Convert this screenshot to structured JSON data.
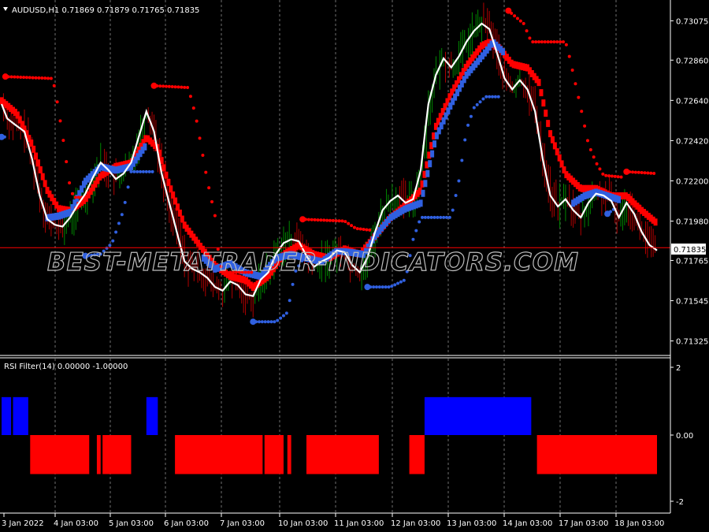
{
  "main_panel": {
    "header": "AUDUSD,H1  0.71869 0.71879 0.71765 0.71835",
    "symbol_menu_icon": "triangle-down-icon",
    "price_labels": [
      "0.73075",
      "0.72860",
      "0.72640",
      "0.72420",
      "0.72200",
      "0.71980",
      "0.71765",
      "0.71545",
      "0.71325"
    ],
    "current_price": "0.71835",
    "watermark": "BEST-METATRADER-INDICATORS.COM"
  },
  "sub_panel": {
    "header": "RSI Filter(14) 0.00000 -1.00000",
    "scale_labels": [
      "2",
      "0.00",
      "-2"
    ]
  },
  "x_axis": {
    "labels": [
      "3 Jan 2022",
      "4 Jan 03:00",
      "5 Jan 03:00",
      "6 Jan 03:00",
      "7 Jan 03:00",
      "10 Jan 03:00",
      "11 Jan 03:00",
      "12 Jan 03:00",
      "13 Jan 03:00",
      "14 Jan 03:00",
      "17 Jan 03:00",
      "18 Jan 03:00"
    ]
  },
  "colors": {
    "background": "#000000",
    "grid": "#ffffff",
    "bull_candle": "#00a000",
    "bear_candle": "#d00000",
    "band_red": "#ff0000",
    "band_blue": "#3060e0",
    "price_line": "#ffffff",
    "current_price_line": "#ff0000",
    "rsi_up": "#0000ff",
    "rsi_down": "#ff0000"
  },
  "chart_data": {
    "type": "line",
    "y_range": [
      0.7125,
      0.7318
    ],
    "price_line": [
      [
        0,
        0.7262
      ],
      [
        3,
        0.7254
      ],
      [
        8,
        0.725
      ],
      [
        12,
        0.7247
      ],
      [
        16,
        0.7232
      ],
      [
        20,
        0.7212
      ],
      [
        24,
        0.7199
      ],
      [
        28,
        0.7196
      ],
      [
        32,
        0.7195
      ],
      [
        36,
        0.72
      ],
      [
        40,
        0.7207
      ],
      [
        44,
        0.7213
      ],
      [
        48,
        0.7222
      ],
      [
        52,
        0.723
      ],
      [
        56,
        0.7226
      ],
      [
        60,
        0.7221
      ],
      [
        64,
        0.7224
      ],
      [
        68,
        0.723
      ],
      [
        72,
        0.7244
      ],
      [
        76,
        0.7258
      ],
      [
        80,
        0.7247
      ],
      [
        84,
        0.7224
      ],
      [
        88,
        0.7208
      ],
      [
        92,
        0.7192
      ],
      [
        96,
        0.7176
      ],
      [
        100,
        0.7172
      ],
      [
        104,
        0.717
      ],
      [
        108,
        0.7167
      ],
      [
        112,
        0.7162
      ],
      [
        116,
        0.716
      ],
      [
        120,
        0.7165
      ],
      [
        124,
        0.7163
      ],
      [
        128,
        0.7158
      ],
      [
        132,
        0.7157
      ],
      [
        136,
        0.7166
      ],
      [
        140,
        0.717
      ],
      [
        144,
        0.718
      ],
      [
        148,
        0.7186
      ],
      [
        152,
        0.7188
      ],
      [
        156,
        0.7187
      ],
      [
        160,
        0.7179
      ],
      [
        164,
        0.7173
      ],
      [
        168,
        0.7176
      ],
      [
        172,
        0.7178
      ],
      [
        176,
        0.7182
      ],
      [
        180,
        0.7181
      ],
      [
        184,
        0.7174
      ],
      [
        188,
        0.717
      ],
      [
        192,
        0.7178
      ],
      [
        196,
        0.7192
      ],
      [
        200,
        0.7204
      ],
      [
        204,
        0.7209
      ],
      [
        208,
        0.7212
      ],
      [
        212,
        0.7208
      ],
      [
        216,
        0.721
      ],
      [
        220,
        0.7226
      ],
      [
        224,
        0.7262
      ],
      [
        228,
        0.7278
      ],
      [
        232,
        0.7287
      ],
      [
        236,
        0.7282
      ],
      [
        240,
        0.7288
      ],
      [
        244,
        0.7296
      ],
      [
        248,
        0.7302
      ],
      [
        252,
        0.7306
      ],
      [
        256,
        0.7303
      ],
      [
        260,
        0.729
      ],
      [
        264,
        0.7276
      ],
      [
        268,
        0.727
      ],
      [
        272,
        0.7275
      ],
      [
        276,
        0.727
      ],
      [
        280,
        0.7258
      ],
      [
        284,
        0.7232
      ],
      [
        288,
        0.7212
      ],
      [
        292,
        0.7206
      ],
      [
        296,
        0.721
      ],
      [
        300,
        0.7204
      ],
      [
        304,
        0.72
      ],
      [
        308,
        0.7208
      ],
      [
        312,
        0.7213
      ],
      [
        316,
        0.7212
      ],
      [
        320,
        0.7209
      ],
      [
        324,
        0.72
      ],
      [
        328,
        0.7208
      ],
      [
        332,
        0.7202
      ],
      [
        336,
        0.7192
      ],
      [
        340,
        0.7185
      ],
      [
        344,
        0.7182
      ]
    ],
    "red_band": [
      [
        0,
        0.7264
      ],
      [
        8,
        0.7257
      ],
      [
        16,
        0.724
      ],
      [
        24,
        0.7215
      ],
      [
        30,
        0.7205
      ],
      [
        36,
        0.7204
      ],
      [
        44,
        0.721
      ],
      [
        52,
        0.7223
      ],
      [
        60,
        0.7228
      ],
      [
        68,
        0.723
      ],
      [
        76,
        0.7244
      ],
      [
        82,
        0.7238
      ],
      [
        88,
        0.7218
      ],
      [
        96,
        0.7196
      ],
      [
        104,
        0.7185
      ],
      [
        112,
        0.7174
      ],
      [
        120,
        0.7168
      ],
      [
        128,
        0.7166
      ],
      [
        132,
        0.7162
      ],
      [
        140,
        0.7168
      ],
      [
        148,
        0.718
      ],
      [
        156,
        0.7185
      ],
      [
        164,
        0.718
      ],
      [
        172,
        0.7178
      ],
      [
        180,
        0.7183
      ],
      [
        188,
        0.718
      ],
      [
        196,
        0.719
      ],
      [
        204,
        0.72
      ],
      [
        212,
        0.7207
      ],
      [
        220,
        0.7215
      ],
      [
        228,
        0.725
      ],
      [
        236,
        0.7268
      ],
      [
        244,
        0.7283
      ],
      [
        252,
        0.7294
      ],
      [
        256,
        0.7296
      ],
      [
        262,
        0.7292
      ],
      [
        268,
        0.7284
      ],
      [
        276,
        0.7282
      ],
      [
        282,
        0.7274
      ],
      [
        288,
        0.7246
      ],
      [
        296,
        0.7224
      ],
      [
        304,
        0.7216
      ],
      [
        312,
        0.7216
      ],
      [
        320,
        0.7212
      ],
      [
        328,
        0.7212
      ],
      [
        336,
        0.7204
      ],
      [
        344,
        0.7197
      ]
    ],
    "blue_band": [
      [
        24,
        0.72
      ],
      [
        30,
        0.7201
      ],
      [
        36,
        0.7203
      ],
      [
        44,
        0.722
      ],
      [
        52,
        0.7228
      ],
      [
        60,
        0.7226
      ],
      [
        68,
        0.7228
      ],
      [
        76,
        0.724
      ],
      [
        106,
        0.7178
      ],
      [
        112,
        0.7172
      ],
      [
        120,
        0.7175
      ],
      [
        128,
        0.717
      ],
      [
        136,
        0.7168
      ],
      [
        144,
        0.7178
      ],
      [
        152,
        0.718
      ],
      [
        160,
        0.7178
      ],
      [
        168,
        0.7176
      ],
      [
        176,
        0.7182
      ],
      [
        184,
        0.7181
      ],
      [
        190,
        0.718
      ],
      [
        196,
        0.719
      ],
      [
        204,
        0.72
      ],
      [
        212,
        0.7205
      ],
      [
        220,
        0.7208
      ],
      [
        228,
        0.7244
      ],
      [
        236,
        0.7262
      ],
      [
        244,
        0.7278
      ],
      [
        252,
        0.7288
      ],
      [
        258,
        0.7296
      ],
      [
        264,
        0.729
      ],
      [
        300,
        0.7208
      ],
      [
        306,
        0.7212
      ],
      [
        312,
        0.7214
      ],
      [
        318,
        0.7212
      ],
      [
        324,
        0.721
      ]
    ],
    "red_stop": [
      [
        [
          2,
          0.7277
        ],
        [
          26,
          0.7276
        ],
        [
          28,
          0.7271
        ],
        [
          32,
          0.7245
        ],
        [
          36,
          0.7216
        ],
        [
          38,
          0.7211
        ],
        [
          44,
          0.7211
        ]
      ],
      [
        [
          80,
          0.7272
        ],
        [
          98,
          0.7271
        ],
        [
          102,
          0.7255
        ],
        [
          108,
          0.722
        ],
        [
          112,
          0.7201
        ],
        [
          114,
          0.7178
        ],
        [
          116,
          0.717
        ],
        [
          132,
          0.717
        ]
      ],
      [
        [
          158,
          0.7199
        ],
        [
          180,
          0.7198
        ],
        [
          186,
          0.7194
        ],
        [
          194,
          0.7193
        ]
      ],
      [
        [
          266,
          0.7313
        ],
        [
          274,
          0.7306
        ],
        [
          278,
          0.7296
        ],
        [
          296,
          0.7296
        ],
        [
          298,
          0.7288
        ],
        [
          304,
          0.726
        ],
        [
          308,
          0.724
        ],
        [
          312,
          0.723
        ],
        [
          316,
          0.7223
        ],
        [
          326,
          0.7222
        ]
      ],
      [
        [
          328,
          0.7225
        ],
        [
          344,
          0.7224
        ]
      ]
    ],
    "blue_stop": [
      [
        [
          0,
          0.7244
        ],
        [
          2,
          0.7244
        ]
      ],
      [
        [
          44,
          0.7179
        ],
        [
          52,
          0.718
        ],
        [
          58,
          0.7186
        ],
        [
          64,
          0.7204
        ],
        [
          68,
          0.7225
        ],
        [
          80,
          0.7225
        ]
      ],
      [
        [
          132,
          0.7143
        ],
        [
          144,
          0.7143
        ],
        [
          150,
          0.7148
        ],
        [
          154,
          0.717
        ],
        [
          158,
          0.7177
        ]
      ],
      [
        [
          192,
          0.7162
        ],
        [
          204,
          0.7162
        ],
        [
          212,
          0.7166
        ],
        [
          216,
          0.7188
        ],
        [
          220,
          0.72
        ],
        [
          236,
          0.72
        ],
        [
          240,
          0.722
        ],
        [
          244,
          0.7248
        ],
        [
          248,
          0.726
        ],
        [
          254,
          0.7266
        ],
        [
          262,
          0.7266
        ]
      ],
      [
        [
          318,
          0.7202
        ],
        [
          322,
          0.7205
        ]
      ]
    ],
    "horizontal_level": 0.71835,
    "rsi_filter": {
      "y_range": [
        -2.0,
        2.0
      ],
      "up_blocks": [
        [
          0,
          5
        ],
        [
          6,
          14
        ],
        [
          76,
          82
        ],
        [
          222,
          278
        ]
      ],
      "down_blocks": [
        [
          15,
          46
        ],
        [
          50,
          52
        ],
        [
          53,
          68
        ],
        [
          91,
          137
        ],
        [
          138,
          148
        ],
        [
          150,
          152
        ],
        [
          160,
          198
        ],
        [
          214,
          222
        ],
        [
          281,
          344
        ]
      ]
    }
  }
}
